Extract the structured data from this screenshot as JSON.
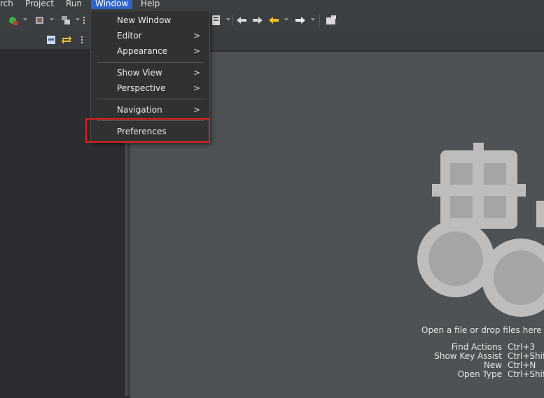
{
  "menubar": {
    "items": [
      {
        "label": "rch"
      },
      {
        "label": "Project"
      },
      {
        "label": "Run"
      },
      {
        "label": "Window",
        "active": true
      },
      {
        "label": "Help"
      }
    ]
  },
  "window_menu": {
    "items": [
      {
        "label": "New Window",
        "submenu": false
      },
      {
        "label": "Editor",
        "submenu": true,
        "arrow": ">"
      },
      {
        "label": "Appearance",
        "submenu": true,
        "arrow": ">"
      },
      {
        "label": "Show View",
        "submenu": true,
        "arrow": ">"
      },
      {
        "label": "Perspective",
        "submenu": true,
        "arrow": ">"
      },
      {
        "label": "Navigation",
        "submenu": true,
        "arrow": ">"
      },
      {
        "label": "Preferences",
        "submenu": false,
        "highlighted": true
      }
    ]
  },
  "editor_hints": {
    "open_text": "Open a file or drop files here to o",
    "shortcuts": [
      {
        "label": "Find Actions",
        "key": "Ctrl+3"
      },
      {
        "label": "Show Key Assist",
        "key": "Ctrl+Shift"
      },
      {
        "label": "New",
        "key": "Ctrl+N"
      },
      {
        "label": "Open Type",
        "key": "Ctrl+Shift"
      }
    ]
  },
  "icons": {
    "toolbar": [
      "debug-icon",
      "stop-icon",
      "external-tools-icon",
      "view-menu-icon",
      "open-task-icon",
      "back-icon",
      "forward-icon",
      "prev-edit-icon",
      "next-edit-icon",
      "pin-editor-icon"
    ],
    "left_view": [
      "collapse-all-icon",
      "link-editor-icon",
      "view-menu-icon"
    ],
    "editor": "eclipse-drop-target-icon"
  },
  "colors": {
    "accent": "#2f65ca",
    "highlight_box": "#e0201c",
    "editor_bg": "#4e5254",
    "menu_bg": "#2f3133"
  }
}
